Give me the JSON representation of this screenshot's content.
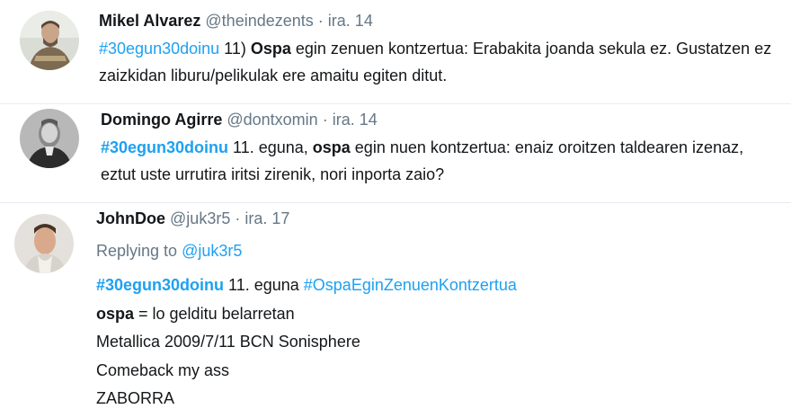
{
  "tweets": [
    {
      "name": "Mikel Alvarez",
      "handle": "@theindezents",
      "sep": "·",
      "date": "ira. 14",
      "hashtag": "#30egun30doinu",
      "text_a": " 11) ",
      "bold": "Ospa",
      "text_b": " egin zenuen kontzertua: Erabakita joanda sekula ez. Gustatzen ez zaizkidan liburu/pelikulak ere amaitu egiten ditut."
    },
    {
      "name": "Domingo Agirre",
      "handle": "@dontxomin",
      "sep": "·",
      "date": "ira. 14",
      "hashtag": "#30egun30doinu",
      "text_a": " 11. eguna, ",
      "bold": "ospa",
      "text_b": " egin nuen kontzertua: enaiz oroitzen taldearen izenaz, eztut uste urrutira iritsi zirenik, nori inporta zaio?"
    },
    {
      "name": "JohnDoe",
      "handle": "@juk3r5",
      "sep": "·",
      "date": "ira. 17",
      "replying_prefix": "Replying to ",
      "replying_to": "@juk3r5",
      "hashtag": "#30egun30doinu",
      "text_a": " 11. eguna ",
      "hashtag2": "#OspaEginZenuenKontzertua",
      "bold": "ospa",
      "line2_rest": " = lo gelditu belarretan",
      "line3": "Metallica 2009/7/11 BCN Sonisphere",
      "line4": "Comeback my ass",
      "line5": "ZABORRA"
    }
  ],
  "colors": {
    "link": "#1da1f2",
    "secondary": "#657786",
    "text": "#14171a",
    "divider": "#e6ecf0"
  }
}
